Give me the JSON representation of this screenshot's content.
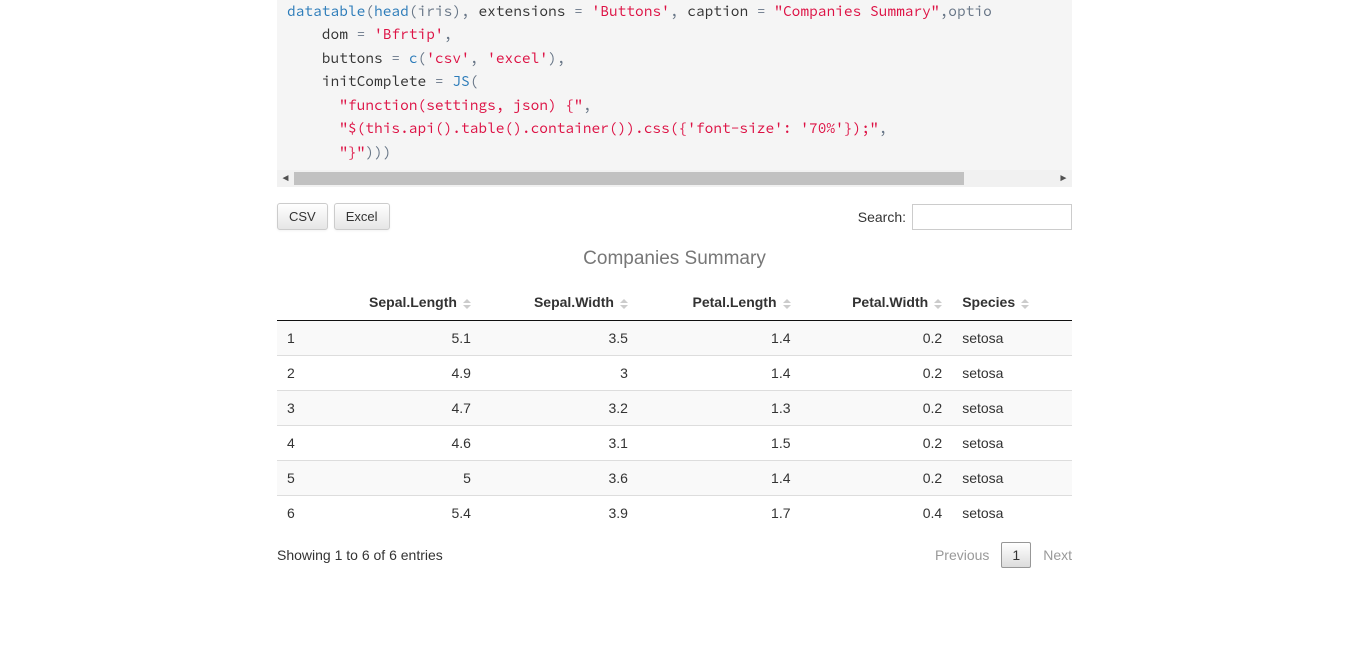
{
  "code": {
    "line1_a": "datatable",
    "line1_b": "(",
    "line1_c": "head",
    "line1_d": "(iris), ",
    "line1_e": "extensions",
    "line1_f": " = ",
    "line1_g": "'Buttons'",
    "line1_h": ", ",
    "line1_i": "caption",
    "line1_j": " = ",
    "line1_k": "\"Companies Summary\"",
    "line1_l": ",optio",
    "line2_a": "    dom",
    "line2_b": " = ",
    "line2_c": "'Bfrtip'",
    "line2_d": ",",
    "line3_a": "    buttons",
    "line3_b": " = ",
    "line3_c": "c",
    "line3_d": "(",
    "line3_e": "'csv'",
    "line3_f": ", ",
    "line3_g": "'excel'",
    "line3_h": "),",
    "line4_a": "    initComplete",
    "line4_b": " = ",
    "line4_c": "JS",
    "line4_d": "(",
    "line5_a": "      ",
    "line5_b": "\"function(settings, json) {\"",
    "line5_c": ",",
    "line6_a": "      ",
    "line6_b": "\"$(this.api().table().container()).css({'font-size': '70%'});\"",
    "line6_c": ",",
    "line7_a": "      ",
    "line7_b": "\"}\"",
    "line7_c": ")))"
  },
  "buttons": {
    "csv": "CSV",
    "excel": "Excel"
  },
  "search": {
    "label": "Search:",
    "value": ""
  },
  "table": {
    "caption": "Companies Summary",
    "headers": [
      "Sepal.Length",
      "Sepal.Width",
      "Petal.Length",
      "Petal.Width",
      "Species"
    ],
    "rows": [
      {
        "i": "1",
        "c": [
          "5.1",
          "3.5",
          "1.4",
          "0.2",
          "setosa"
        ]
      },
      {
        "i": "2",
        "c": [
          "4.9",
          "3",
          "1.4",
          "0.2",
          "setosa"
        ]
      },
      {
        "i": "3",
        "c": [
          "4.7",
          "3.2",
          "1.3",
          "0.2",
          "setosa"
        ]
      },
      {
        "i": "4",
        "c": [
          "4.6",
          "3.1",
          "1.5",
          "0.2",
          "setosa"
        ]
      },
      {
        "i": "5",
        "c": [
          "5",
          "3.6",
          "1.4",
          "0.2",
          "setosa"
        ]
      },
      {
        "i": "6",
        "c": [
          "5.4",
          "3.9",
          "1.7",
          "0.4",
          "setosa"
        ]
      }
    ]
  },
  "footer": {
    "info": "Showing 1 to 6 of 6 entries",
    "prev": "Previous",
    "page": "1",
    "next": "Next"
  }
}
